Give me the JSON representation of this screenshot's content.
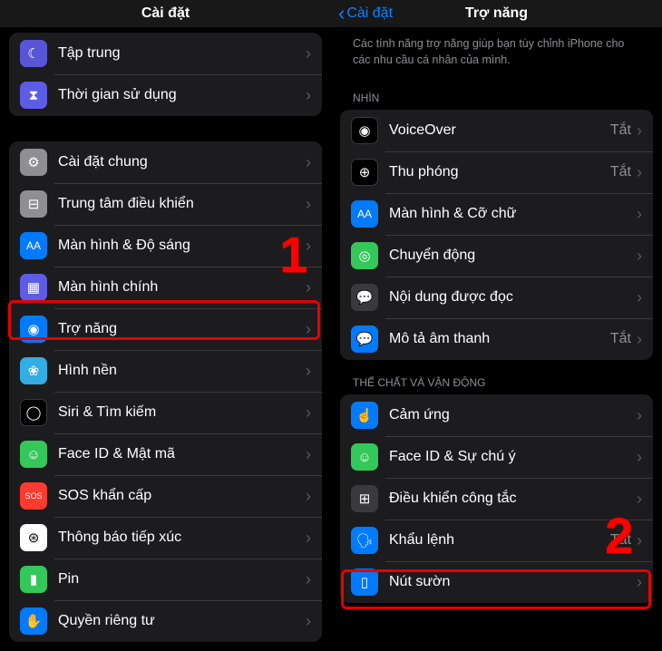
{
  "left": {
    "title": "Cài đặt",
    "group1": [
      {
        "label": "Tập trung",
        "iconName": "focus-icon",
        "bg": "bg-purple",
        "glyph": "☾"
      },
      {
        "label": "Thời gian sử dụng",
        "iconName": "screentime-icon",
        "bg": "bg-indigo",
        "glyph": "⧗"
      }
    ],
    "group2": [
      {
        "label": "Cài đặt chung",
        "iconName": "general-icon",
        "bg": "bg-gray",
        "glyph": "⚙"
      },
      {
        "label": "Trung tâm điều khiển",
        "iconName": "controlcenter-icon",
        "bg": "bg-gray",
        "glyph": "⊟"
      },
      {
        "label": "Màn hình & Độ sáng",
        "iconName": "display-icon",
        "bg": "bg-blue",
        "glyph": "AA"
      },
      {
        "label": "Màn hình chính",
        "iconName": "homescreen-icon",
        "bg": "bg-indigo",
        "glyph": "▦"
      },
      {
        "label": "Trợ năng",
        "iconName": "accessibility-icon",
        "bg": "bg-blue",
        "glyph": "◉"
      },
      {
        "label": "Hình nền",
        "iconName": "wallpaper-icon",
        "bg": "bg-cyan",
        "glyph": "❀"
      },
      {
        "label": "Siri & Tìm kiếm",
        "iconName": "siri-icon",
        "bg": "bg-black",
        "glyph": "◯"
      },
      {
        "label": "Face ID & Mật mã",
        "iconName": "faceid-icon",
        "bg": "bg-green",
        "glyph": "☺"
      },
      {
        "label": "SOS khẩn cấp",
        "iconName": "sos-icon",
        "bg": "bg-red",
        "glyph": "SOS"
      },
      {
        "label": "Thông báo tiếp xúc",
        "iconName": "exposure-icon",
        "bg": "bg-white",
        "glyph": "⊛"
      },
      {
        "label": "Pin",
        "iconName": "battery-icon",
        "bg": "bg-green",
        "glyph": "▮"
      },
      {
        "label": "Quyền riêng tư",
        "iconName": "privacy-icon",
        "bg": "bg-blue",
        "glyph": "✋"
      }
    ]
  },
  "right": {
    "back": "Cài đặt",
    "title": "Trợ năng",
    "desc": "Các tính năng trợ năng giúp bạn tùy chỉnh iPhone cho các nhu cầu cá nhân của mình.",
    "section1": "NHÌN",
    "group1": [
      {
        "label": "VoiceOver",
        "value": "Tắt",
        "iconName": "voiceover-icon",
        "bg": "bg-black",
        "glyph": "◉"
      },
      {
        "label": "Thu phóng",
        "value": "Tắt",
        "iconName": "zoom-icon",
        "bg": "bg-black",
        "glyph": "⊕"
      },
      {
        "label": "Màn hình & Cỡ chữ",
        "value": "",
        "iconName": "textsize-icon",
        "bg": "bg-blue",
        "glyph": "AA"
      },
      {
        "label": "Chuyển động",
        "value": "",
        "iconName": "motion-icon",
        "bg": "bg-green",
        "glyph": "◎"
      },
      {
        "label": "Nội dung được đọc",
        "value": "",
        "iconName": "spoken-icon",
        "bg": "bg-darkgray",
        "glyph": "💬"
      },
      {
        "label": "Mô tả âm thanh",
        "value": "Tắt",
        "iconName": "audiodesc-icon",
        "bg": "bg-blue",
        "glyph": "💬"
      }
    ],
    "section2": "THỂ CHẤT VÀ VẬN ĐỘNG",
    "group2": [
      {
        "label": "Cảm ứng",
        "value": "",
        "iconName": "touch-icon",
        "bg": "bg-blue",
        "glyph": "☝"
      },
      {
        "label": "Face ID & Sự chú ý",
        "value": "",
        "iconName": "faceid2-icon",
        "bg": "bg-green",
        "glyph": "☺"
      },
      {
        "label": "Điều khiển công tắc",
        "value": "",
        "iconName": "switch-icon",
        "bg": "bg-darkgray",
        "glyph": "⊞"
      },
      {
        "label": "Khẩu lệnh",
        "value": "Tắt",
        "iconName": "voice-icon",
        "bg": "bg-blue",
        "glyph": "🗣"
      },
      {
        "label": "Nút sườn",
        "value": "",
        "iconName": "sidebutton-icon",
        "bg": "bg-blue",
        "glyph": "▯"
      }
    ]
  },
  "annotations": {
    "one": "1",
    "two": "2"
  }
}
